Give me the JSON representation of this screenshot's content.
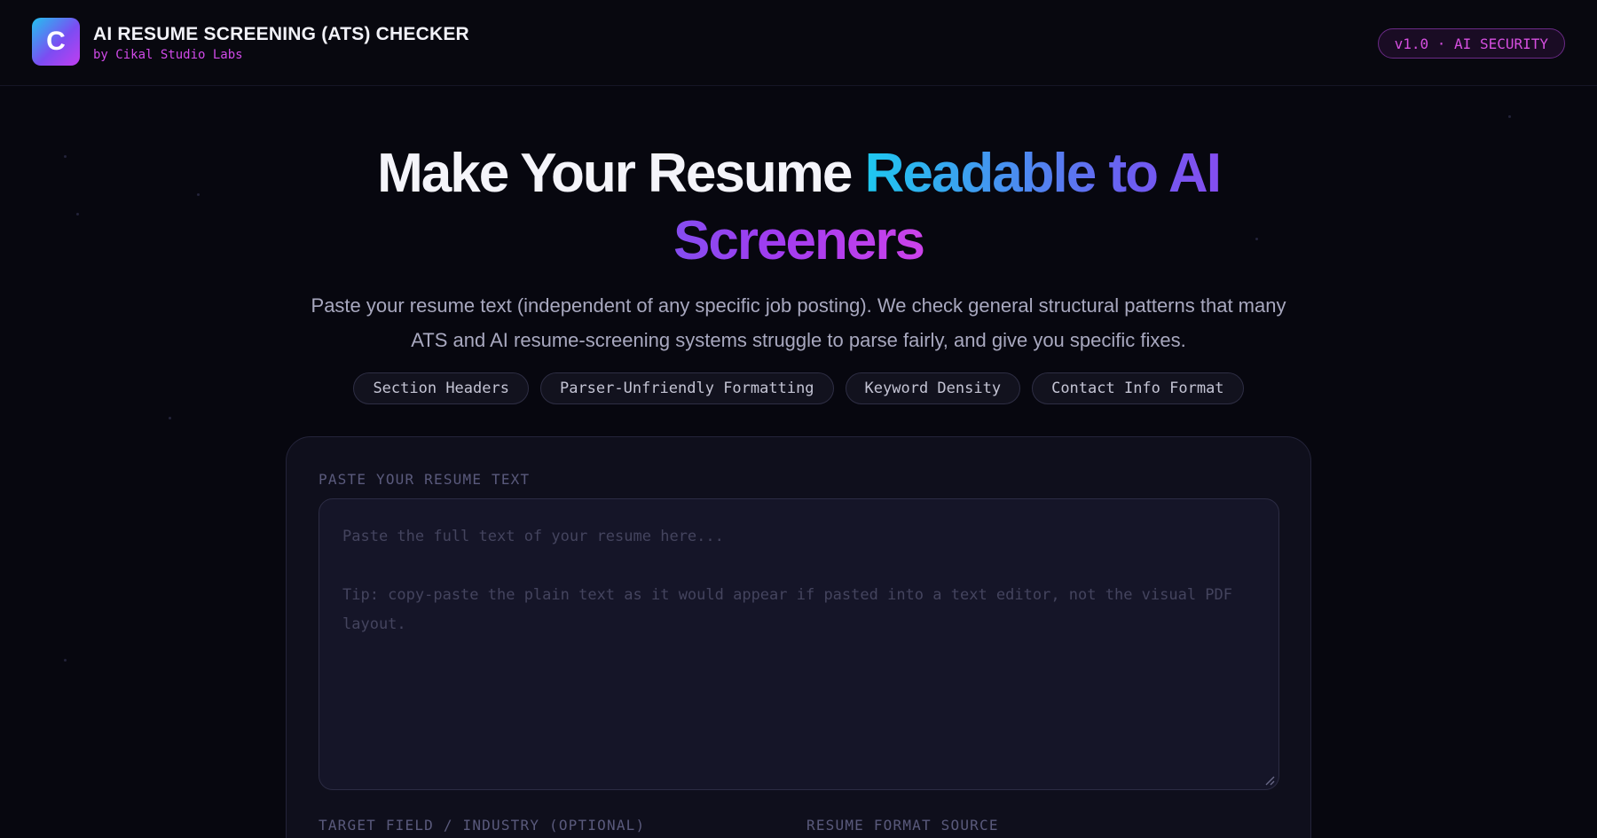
{
  "header": {
    "logo_letter": "C",
    "title": "AI RESUME SCREENING (ATS) CHECKER",
    "subtitle": "by Cikal Studio Labs",
    "version_badge": "v1.0 · AI SECURITY"
  },
  "hero": {
    "title_plain": "Make Your Resume ",
    "title_highlight": "Readable to AI Screeners",
    "subtitle": "Paste your resume text (independent of any specific job posting). We check general structural patterns that many ATS and AI resume-screening systems struggle to parse fairly, and give you specific fixes."
  },
  "chips": [
    "Section Headers",
    "Parser-Unfriendly Formatting",
    "Keyword Density",
    "Contact Info Format"
  ],
  "form": {
    "resume_label": "PASTE YOUR RESUME TEXT",
    "resume_placeholder_line1": "Paste the full text of your resume here...",
    "resume_placeholder_line2": "Tip: copy-paste the plain text as it would appear if pasted into a text editor, not the visual PDF layout.",
    "target_field_label": "TARGET FIELD / INDUSTRY (OPTIONAL)",
    "format_source_label": "RESUME FORMAT SOURCE"
  },
  "colors": {
    "background": "#07070f",
    "accent_pink": "#d04ae8",
    "accent_cyan": "#1ec8ef",
    "accent_violet": "#7b4df2"
  }
}
